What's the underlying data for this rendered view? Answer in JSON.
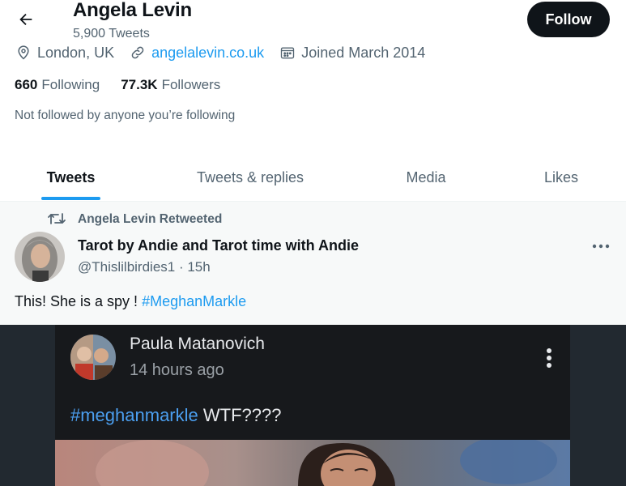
{
  "profile": {
    "name": "Angela Levin",
    "tweet_count": "5,900 Tweets",
    "follow_label": "Follow",
    "location": "London, UK",
    "website": "angelalevin.co.uk",
    "joined": "Joined March 2014",
    "following_count": "660",
    "following_label": "Following",
    "followers_count": "77.3K",
    "followers_label": "Followers",
    "not_followed": "Not followed by anyone you’re following"
  },
  "tabs": [
    {
      "label": "Tweets",
      "active": true
    },
    {
      "label": "Tweets & replies",
      "active": false
    },
    {
      "label": "Media",
      "active": false
    },
    {
      "label": "Likes",
      "active": false
    }
  ],
  "tweet": {
    "retweet_label": "Angela Levin Retweeted",
    "author_name": "Tarot by Andie and Tarot time with Andie",
    "author_handle": "@Thislilbirdies1 · 15h",
    "text": "This!  She is a spy ! ",
    "hashtag": "#MeghanMarkle",
    "media": {
      "name": "Paula Matanovich",
      "time": "14 hours ago",
      "tag": "#meghanmarkle",
      "text": " WTF????"
    }
  },
  "colors": {
    "accent": "#1d9bf0",
    "text": "#0f1419",
    "secondary": "#536471"
  },
  "icons": {
    "back": "arrow-left-icon",
    "location": "location-pin-icon",
    "link": "link-icon",
    "calendar": "calendar-icon",
    "retweet": "retweet-icon",
    "more": "more-dots-icon"
  }
}
